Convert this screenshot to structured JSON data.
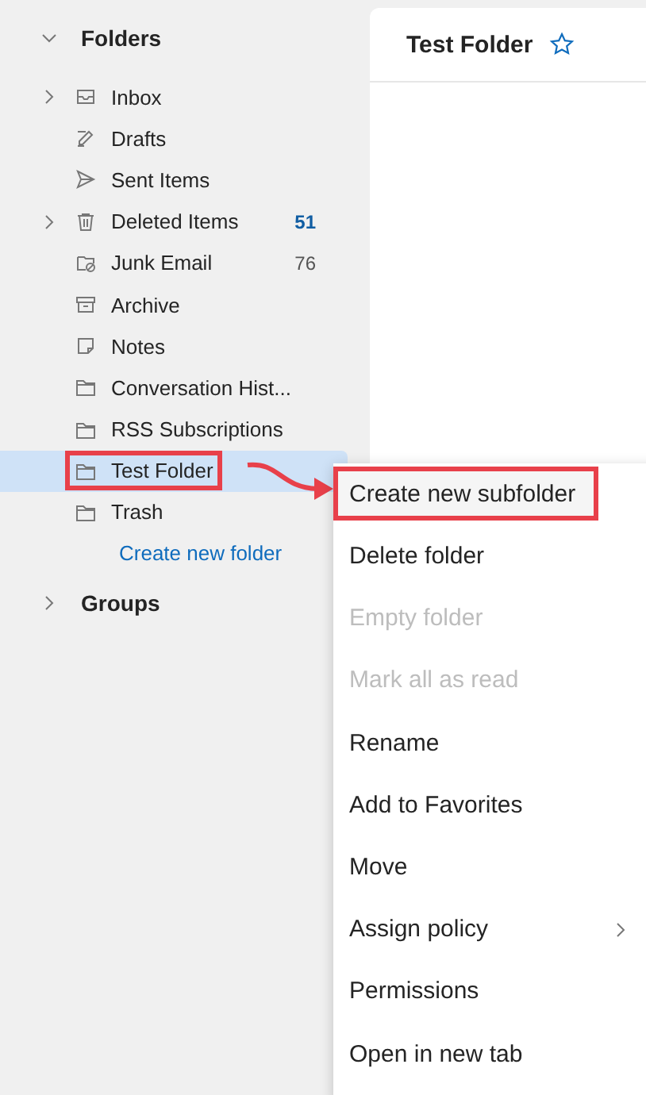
{
  "sidebar": {
    "header": {
      "label": "Folders",
      "expanded": true
    },
    "folders": [
      {
        "label": "Inbox",
        "kind": "inbox",
        "expandable": true,
        "selected": false,
        "highlighted": false
      },
      {
        "label": "Drafts",
        "kind": "drafts",
        "expandable": false,
        "selected": false,
        "highlighted": false
      },
      {
        "label": "Sent Items",
        "kind": "sent",
        "expandable": false,
        "selected": false,
        "highlighted": false
      },
      {
        "label": "Deleted Items",
        "kind": "trash",
        "expandable": true,
        "selected": false,
        "highlighted": false,
        "count": "51",
        "unread": true
      },
      {
        "label": "Junk Email",
        "kind": "junk",
        "expandable": false,
        "selected": false,
        "highlighted": false,
        "count": "76",
        "unread": false
      },
      {
        "label": "Archive",
        "kind": "archive",
        "expandable": false,
        "selected": false,
        "highlighted": false
      },
      {
        "label": "Notes",
        "kind": "notes",
        "expandable": false,
        "selected": false,
        "highlighted": false
      },
      {
        "label": "Conversation Hist...",
        "kind": "folder",
        "expandable": false,
        "selected": false,
        "highlighted": false
      },
      {
        "label": "RSS Subscriptions",
        "kind": "folder",
        "expandable": false,
        "selected": false,
        "highlighted": false
      },
      {
        "label": "Test Folder",
        "kind": "folder",
        "expandable": false,
        "selected": true,
        "highlighted": true
      },
      {
        "label": "Trash",
        "kind": "folder",
        "expandable": false,
        "selected": false,
        "highlighted": false
      }
    ],
    "create_link": "Create new folder",
    "groups": {
      "label": "Groups",
      "expanded": false
    }
  },
  "main": {
    "title": "Test Folder",
    "favorite": false
  },
  "context_menu": [
    {
      "label": "Create new subfolder",
      "disabled": false,
      "highlighted": true,
      "submenu": false
    },
    {
      "label": "Delete folder",
      "disabled": false,
      "highlighted": false,
      "submenu": false
    },
    {
      "label": "Empty folder",
      "disabled": true,
      "highlighted": false,
      "submenu": false
    },
    {
      "label": "Mark all as read",
      "disabled": true,
      "highlighted": false,
      "submenu": false
    },
    {
      "label": "Rename",
      "disabled": false,
      "highlighted": false,
      "submenu": false
    },
    {
      "label": "Add to Favorites",
      "disabled": false,
      "highlighted": false,
      "submenu": false
    },
    {
      "label": "Move",
      "disabled": false,
      "highlighted": false,
      "submenu": false
    },
    {
      "label": "Assign policy",
      "disabled": false,
      "highlighted": false,
      "submenu": true
    },
    {
      "label": "Permissions",
      "disabled": false,
      "highlighted": false,
      "submenu": false
    },
    {
      "label": "Open in new tab",
      "disabled": false,
      "highlighted": false,
      "submenu": false
    }
  ]
}
